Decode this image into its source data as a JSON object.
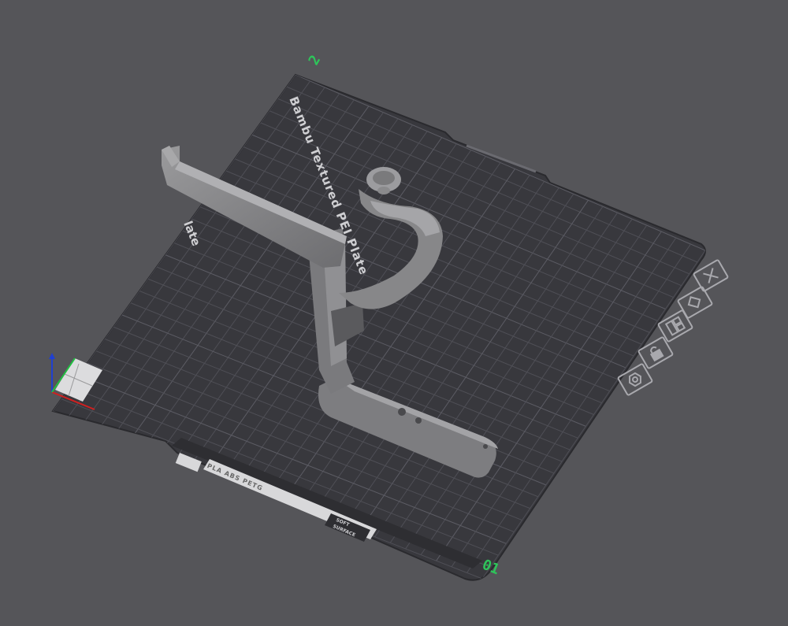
{
  "plate": {
    "brand_text": "Bambu Textured PEI Plate",
    "name_text": "late",
    "material_text": "PLA ABS PETG",
    "badge_line1": "SOFT",
    "badge_line2": "SURFACE",
    "plate_number_top": "2",
    "plate_number_bottom": "01"
  },
  "toolbar": {
    "buttons": [
      {
        "name": "close-icon"
      },
      {
        "name": "auto-orient-icon"
      },
      {
        "name": "arrange-icon"
      },
      {
        "name": "lock-icon"
      },
      {
        "name": "settings-icon"
      }
    ]
  },
  "colors": {
    "background": "#555559",
    "plate": "#3a3a3f",
    "grid": "#505057",
    "model": "#8a8a8c",
    "axis_x": "#d02020",
    "axis_y": "#20c040",
    "axis_z": "#2040d0"
  }
}
